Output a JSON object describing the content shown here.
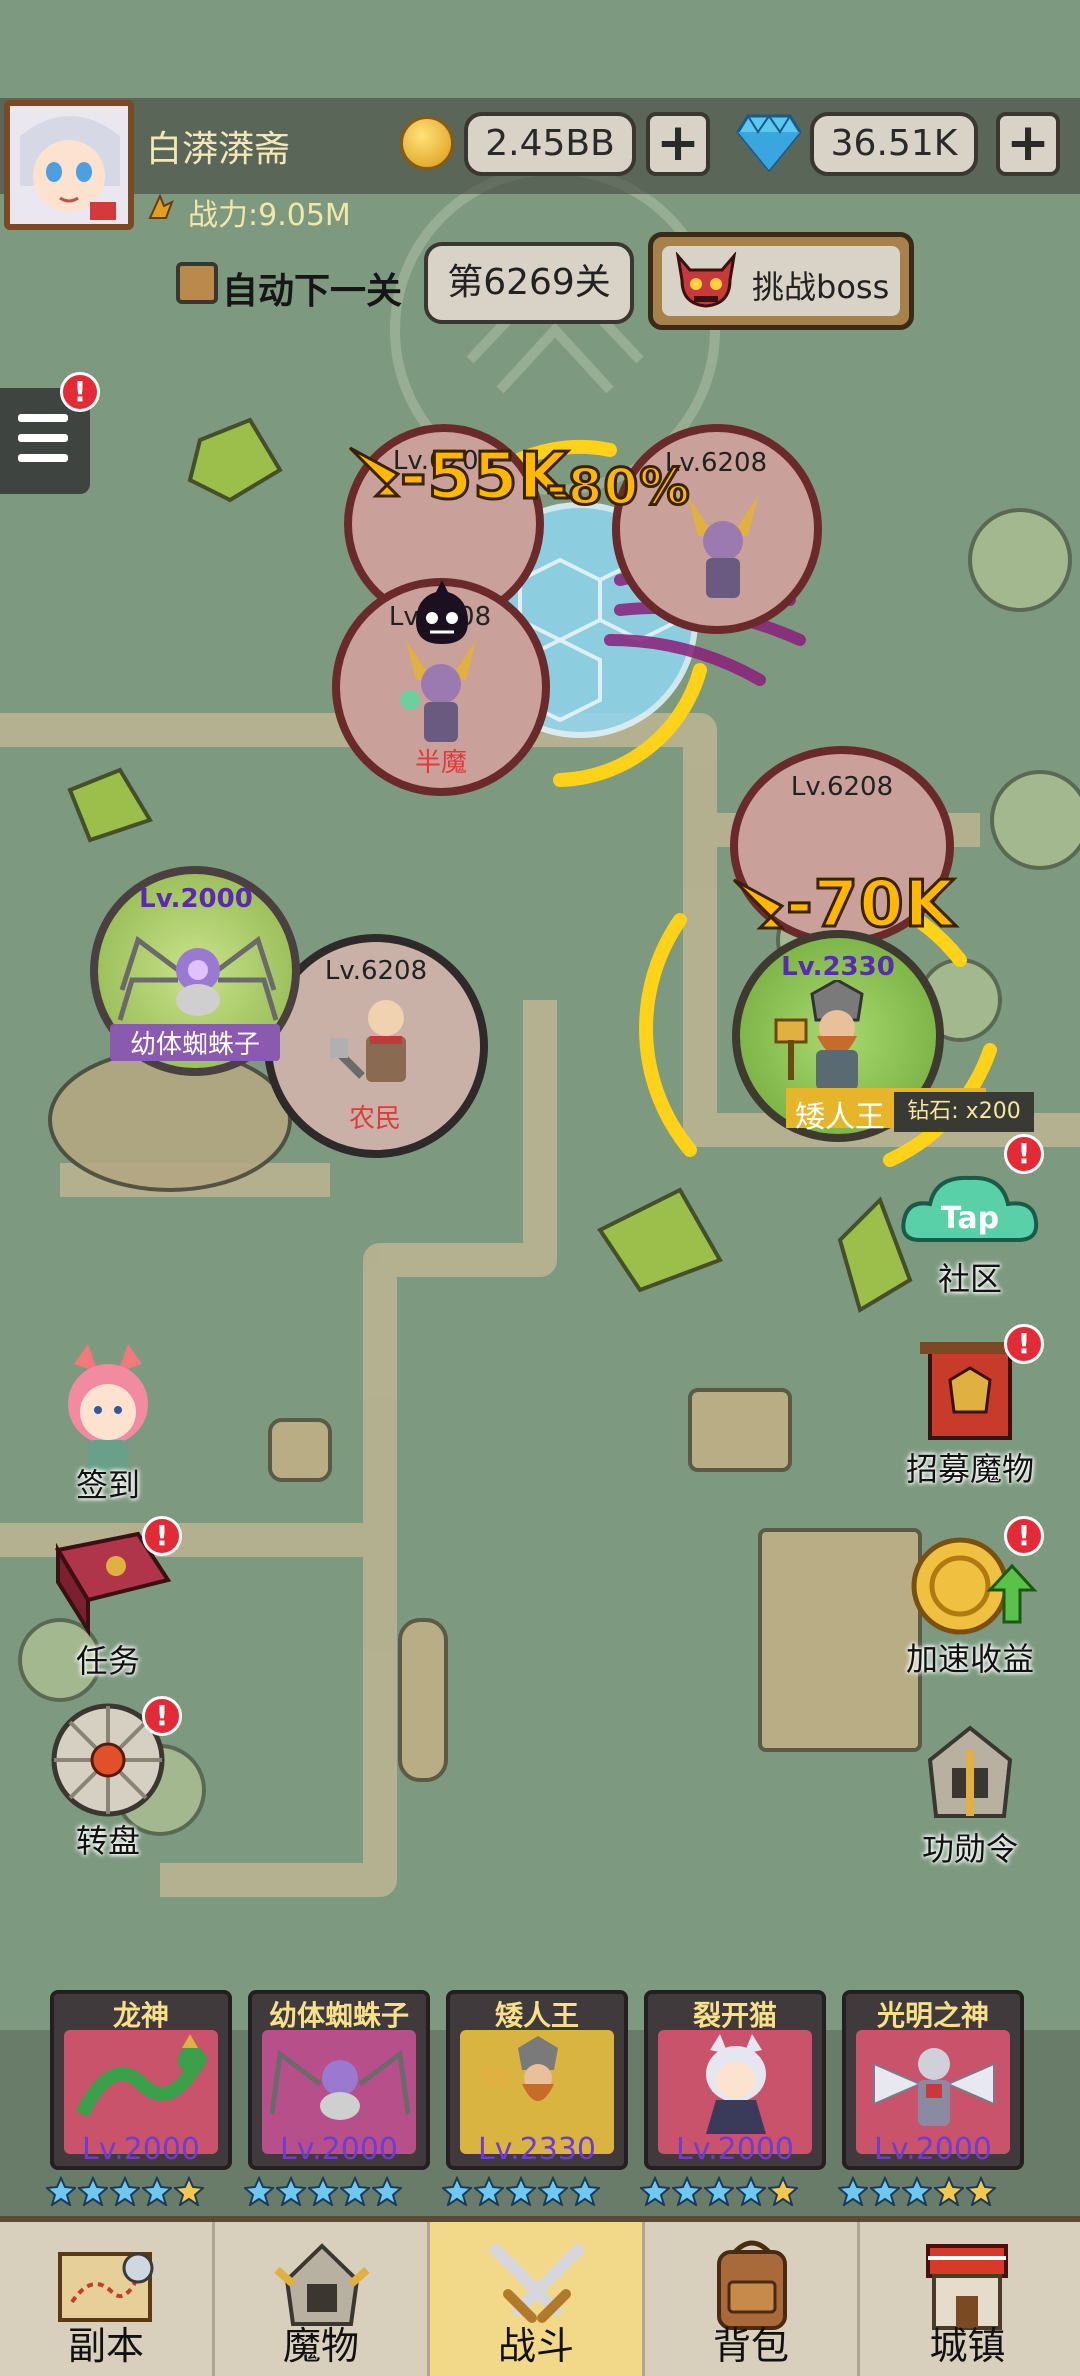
{
  "player": {
    "name": "白漭漭斋",
    "power": "战力:9.05M",
    "gold": "2.45BB",
    "diamonds": "36.51K"
  },
  "stage": {
    "auto_next": "自动下一关",
    "current": "第6269关",
    "boss_button": "挑战boss"
  },
  "battle": {
    "damage_1": "-55K",
    "damage_2": "-80%",
    "damage_3": "-70K",
    "monsters": [
      {
        "level": "Lv.6208",
        "name": ""
      },
      {
        "level": "Lv.6208",
        "name": ""
      },
      {
        "level": "Lv.6208",
        "name": "半魔"
      },
      {
        "level": "Lv.6208",
        "name": ""
      },
      {
        "level": "Lv.6208",
        "name": "农民"
      }
    ],
    "heroes": [
      {
        "level": "Lv.2000",
        "name": "幼体蜘蛛子"
      },
      {
        "level": "Lv.2330",
        "name": "矮人王",
        "reward": "钻石: x200"
      }
    ]
  },
  "side_left": [
    {
      "label": "签到",
      "icon": "fox-girl-icon"
    },
    {
      "label": "任务",
      "icon": "book-icon"
    },
    {
      "label": "转盘",
      "icon": "wheel-icon"
    }
  ],
  "side_right": [
    {
      "label": "社区",
      "icon": "tap-cloud-icon"
    },
    {
      "label": "招募魔物",
      "icon": "banner-icon"
    },
    {
      "label": "加速收益",
      "icon": "coin-up-icon"
    },
    {
      "label": "功勋令",
      "icon": "helmet-icon"
    }
  ],
  "team": [
    {
      "name": "龙神",
      "level": "Lv.2000",
      "stars": 5,
      "gold_stars": 1,
      "bg": "#c8536a"
    },
    {
      "name": "幼体蜘蛛子",
      "level": "Lv.2000",
      "stars": 5,
      "gold_stars": 0,
      "bg": "#b74f8a"
    },
    {
      "name": "矮人王",
      "level": "Lv.2330",
      "stars": 5,
      "gold_stars": 0,
      "bg": "#d9b441"
    },
    {
      "name": "裂开猫",
      "level": "Lv.2000",
      "stars": 5,
      "gold_stars": 1,
      "bg": "#c8536a"
    },
    {
      "name": "光明之神",
      "level": "Lv.2000",
      "stars": 5,
      "gold_stars": 2,
      "bg": "#c8536a"
    }
  ],
  "nav": [
    {
      "label": "副本",
      "icon": "map-scroll-icon"
    },
    {
      "label": "魔物",
      "icon": "monster-helmet-icon"
    },
    {
      "label": "战斗",
      "icon": "crossed-swords-icon"
    },
    {
      "label": "背包",
      "icon": "backpack-icon"
    },
    {
      "label": "城镇",
      "icon": "town-icon"
    }
  ],
  "colors": {
    "map": "#7d9a80",
    "path": "#cdbf98",
    "accent": "#ffb800",
    "alert": "#e22b36"
  }
}
